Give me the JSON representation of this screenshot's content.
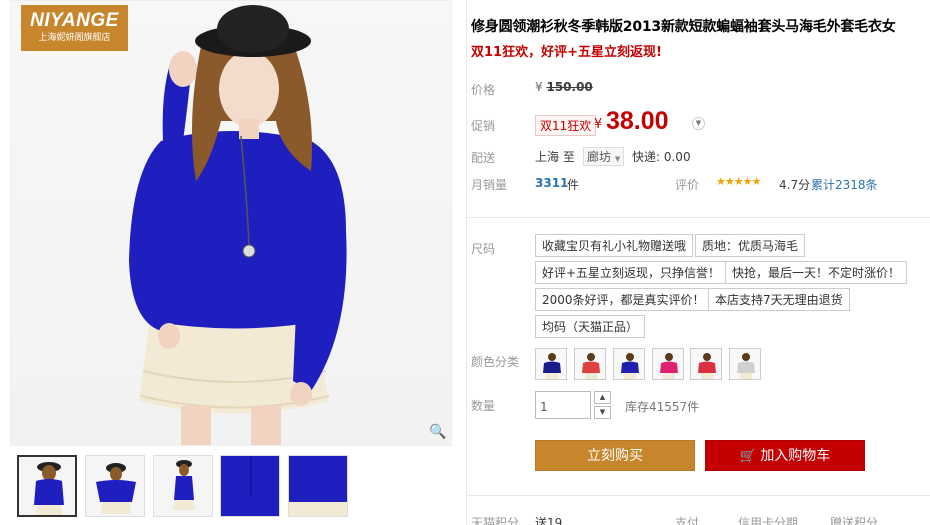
{
  "brand": {
    "name": "NIYANGE",
    "subtitle": "上海妮妍阁旗舰店"
  },
  "product": {
    "title": "修身圆领潮衫秋冬季韩版2013新款短款蝙蝠袖套头马海毛外套毛衣女",
    "promo": "双11狂欢，好评+五星立刻返现!"
  },
  "pricing": {
    "price_label": "价格",
    "currency": "¥",
    "original": "150.00",
    "promo_label": "促销",
    "promo_badge": "双11狂欢",
    "current": "38.00"
  },
  "shipping": {
    "label": "配送",
    "from": "上海",
    "to_word": "至",
    "destination": "廊坊",
    "fee": "快递: 0.00"
  },
  "sales": {
    "label": "月销量",
    "count": "3311",
    "unit": "件",
    "rating_label": "评价",
    "stars": "★★★★★",
    "score": "4.7分",
    "reviews": "累计2318条"
  },
  "size": {
    "label": "尺码",
    "options": [
      "收藏宝贝有礼小礼物赠送哦",
      "质地：优质马海毛",
      "好评+五星立刻返现，只挣信誉！",
      "快抢，最后一天！不定时涨价！",
      "2000条好评，都是真实评价！",
      "本店支持7天无理由退货",
      "均码（天猫正品）"
    ]
  },
  "color": {
    "label": "颜色分类",
    "swatches": [
      "#1a1a8c",
      "#e04040",
      "#2020b0",
      "#e02070",
      "#d83040",
      "#d0d0d0"
    ]
  },
  "quantity": {
    "label": "数量",
    "value": "1",
    "stock": "库存41557件"
  },
  "actions": {
    "buy": "立刻购买",
    "cart": "加入购物车"
  },
  "bottom": {
    "points": "天猫积分",
    "points_value": "送19",
    "pay": "支付",
    "credit": "信用卡分期",
    "more": "赠送积分"
  },
  "colors": {
    "accent": "#c8862c",
    "red": "#c40000",
    "link": "#2c72b3",
    "sweater": "#1f1fbf"
  }
}
